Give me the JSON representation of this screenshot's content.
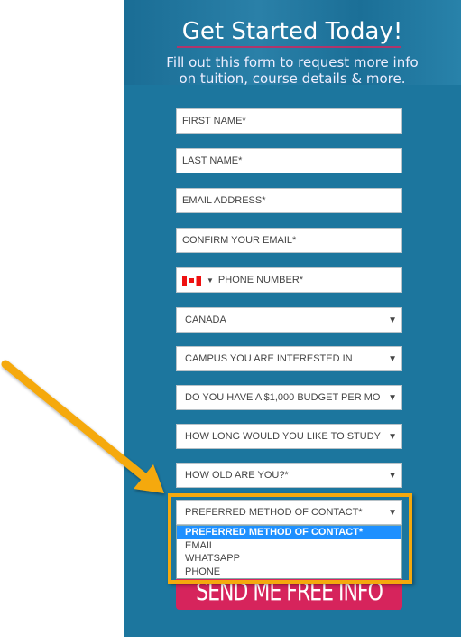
{
  "header": {
    "title": "Get Started Today!",
    "subtitle_line1": "Fill out this form to request more info",
    "subtitle_line2": "on tuition, course details & more."
  },
  "form": {
    "first_name": "FIRST NAME*",
    "last_name": "LAST NAME*",
    "email": "EMAIL ADDRESS*",
    "confirm_email": "CONFIRM YOUR EMAIL*",
    "phone": "PHONE NUMBER*",
    "phone_flag": "canada-flag-icon",
    "country": "CANADA",
    "campus": "CAMPUS YOU ARE INTERESTED IN",
    "budget": "DO YOU HAVE A $1,000 BUDGET PER MO",
    "duration": "HOW LONG WOULD YOU LIKE TO STUDY",
    "age": "HOW OLD ARE YOU?*",
    "contact_method": "PREFERRED METHOD OF CONTACT*",
    "contact_options": [
      "PREFERRED METHOD OF CONTACT*",
      "EMAIL",
      "WHATSAPP",
      "PHONE"
    ],
    "submit": "SEND ME FREE INFO"
  },
  "colors": {
    "panel": "#1c769e",
    "button": "#d6245c",
    "highlight": "#f5a90d",
    "selected_option": "#1e90ff"
  }
}
